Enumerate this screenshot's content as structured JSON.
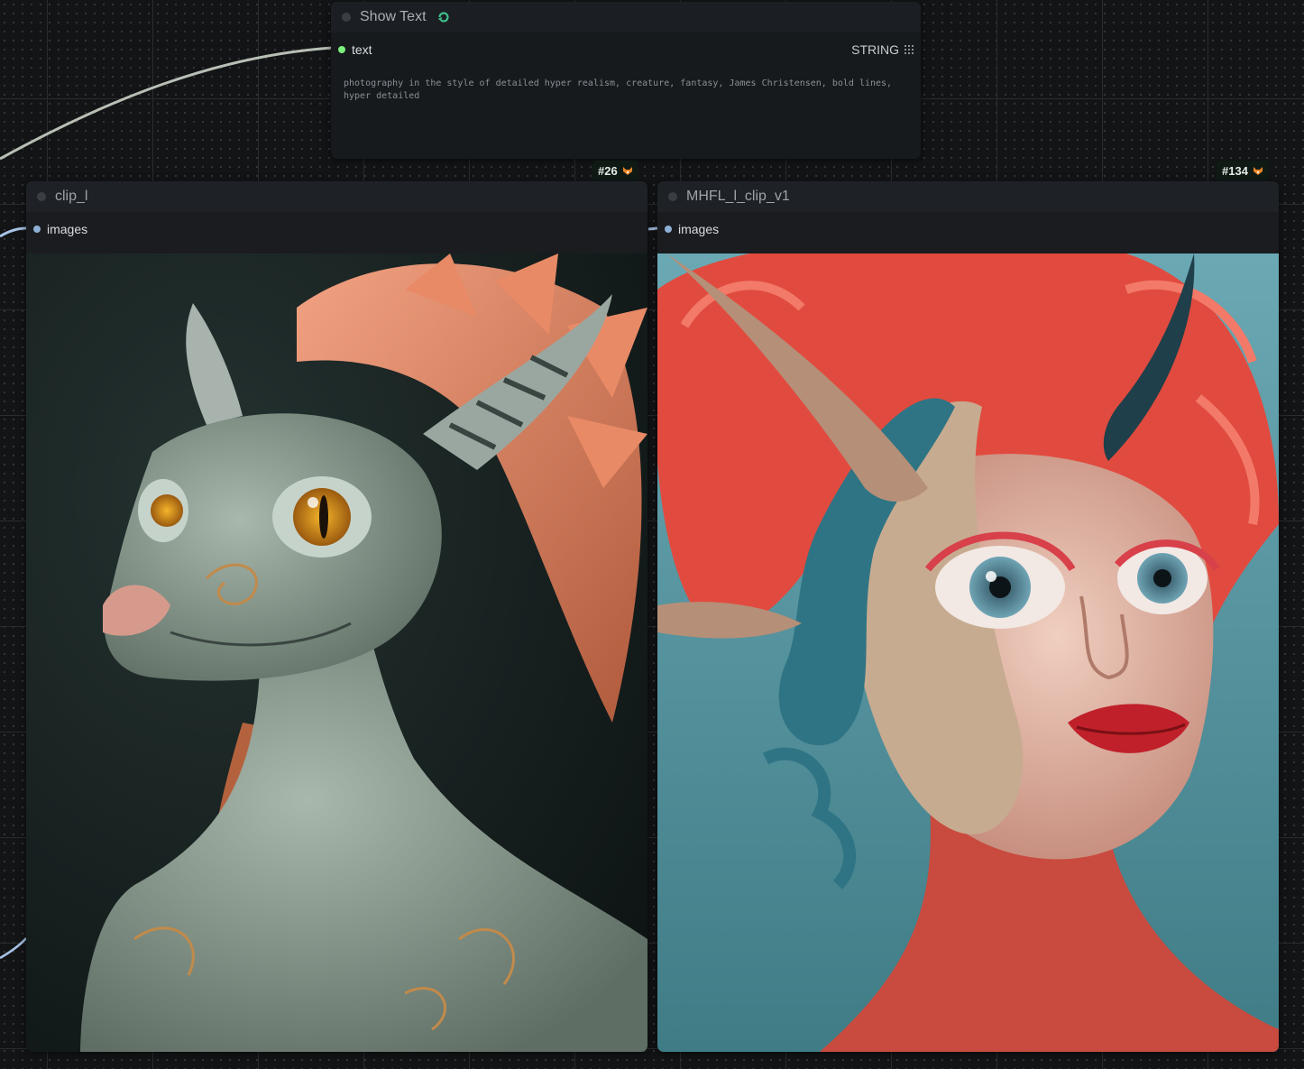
{
  "show_text_node": {
    "title": "Show Text",
    "input_label": "text",
    "type_label": "STRING",
    "text_value": "photography in the style of detailed hyper realism, creature, fantasy, James Christensen, bold lines, hyper detailed"
  },
  "preview_nodes": [
    {
      "title": "clip_l",
      "input_label": "images",
      "badge": "#26",
      "image_desc": "dragon-creature-portrait"
    },
    {
      "title": "MHFL_l_clip_v1",
      "input_label": "images",
      "badge": "#134",
      "image_desc": "horned-woman-portrait"
    }
  ],
  "colors": {
    "canvas_bg": "#131416",
    "node_bg": "#1a1c1f",
    "string_slot": "#7cf07c",
    "image_slot": "#8fb0d6",
    "wire_text": "#b8c0b6",
    "wire_image": "#a8c4e6"
  }
}
